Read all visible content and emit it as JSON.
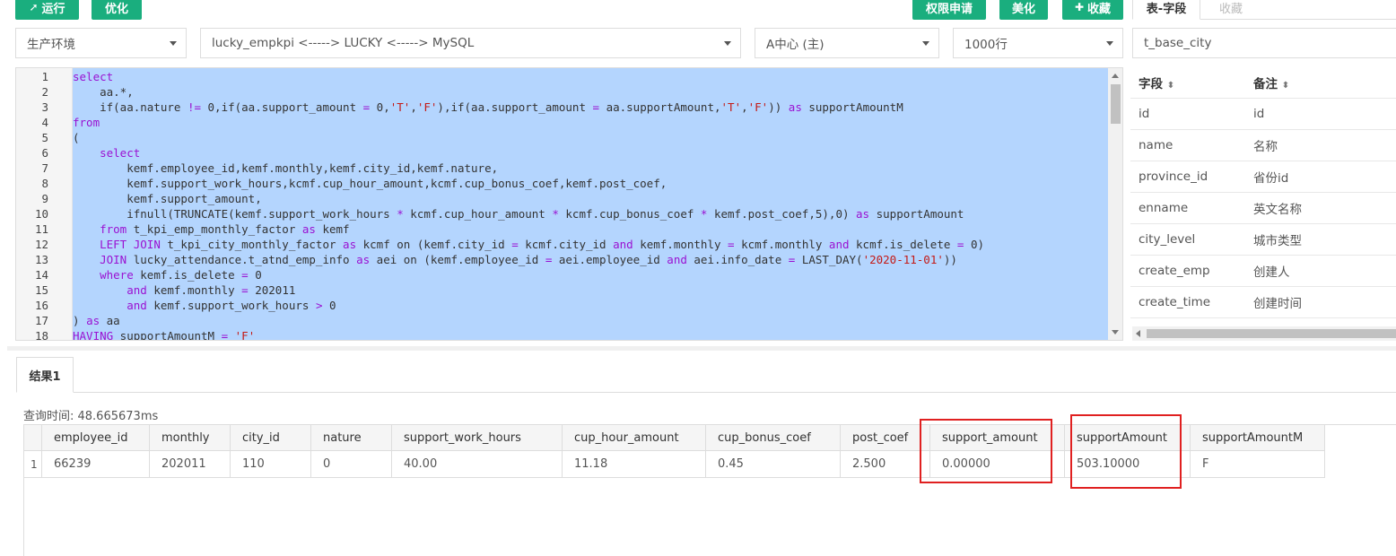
{
  "toolbar": {
    "run": "运行",
    "optimize": "优化",
    "permission": "权限申请",
    "beautify": "美化",
    "favorite": "收藏",
    "tabs": [
      "表-字段",
      "收藏"
    ]
  },
  "selects": {
    "env": "生产环境",
    "datasource": "lucky_empkpi <-----> LUCKY <-----> MySQL",
    "center": "A中心 (主)",
    "rows": "1000行",
    "table": "t_base_city"
  },
  "editor": {
    "line_numbers": [
      "1",
      "2",
      "3",
      "4",
      "5",
      "6",
      "7",
      "8",
      "9",
      "10",
      "11",
      "12",
      "13",
      "14",
      "15",
      "16",
      "17",
      "18"
    ]
  },
  "fields": {
    "headers": [
      "字段",
      "备注"
    ],
    "rows": [
      [
        "id",
        "id"
      ],
      [
        "name",
        "名称"
      ],
      [
        "province_id",
        "省份id"
      ],
      [
        "enname",
        "英文名称"
      ],
      [
        "city_level",
        "城市类型"
      ],
      [
        "create_emp",
        "创建人"
      ],
      [
        "create_time",
        "创建时间"
      ]
    ]
  },
  "results": {
    "tab": "结果1",
    "query_time": "查询时间: 48.665673ms",
    "columns": [
      "employee_id",
      "monthly",
      "city_id",
      "nature",
      "support_work_hours",
      "cup_hour_amount",
      "cup_bonus_coef",
      "post_coef",
      "support_amount",
      "supportAmount",
      "supportAmountM"
    ],
    "row_index": "1",
    "row": [
      "66239",
      "202011",
      "110",
      "0",
      "40.00",
      "11.18",
      "0.45",
      "2.500",
      "0.00000",
      "503.10000",
      "F"
    ]
  },
  "colors": {
    "button_green": "#1aae7e",
    "selection": "#b4d5fe",
    "highlight_red": "#e02020"
  }
}
